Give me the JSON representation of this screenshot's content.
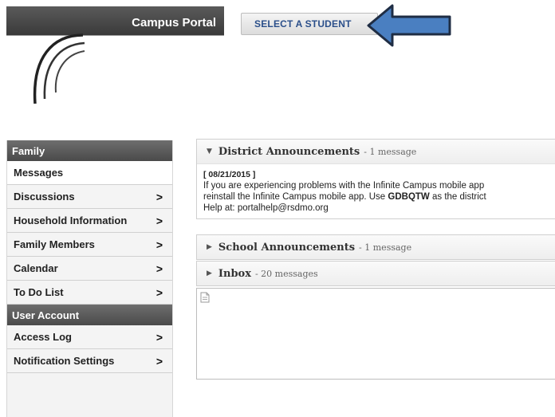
{
  "header": {
    "app_title": "Campus Portal",
    "select_student_label": "SELECT A STUDENT"
  },
  "sidebar": {
    "family_header": "Family",
    "family_items": [
      {
        "label": "Messages",
        "has_chevron": false,
        "active": true
      },
      {
        "label": "Discussions",
        "has_chevron": true
      },
      {
        "label": "Household Information",
        "has_chevron": true
      },
      {
        "label": "Family Members",
        "has_chevron": true
      },
      {
        "label": "Calendar",
        "has_chevron": true
      },
      {
        "label": "To Do List",
        "has_chevron": true
      }
    ],
    "account_header": "User Account",
    "account_items": [
      {
        "label": "Access Log",
        "has_chevron": true
      },
      {
        "label": "Notification Settings",
        "has_chevron": true
      }
    ],
    "chevron": ">"
  },
  "district": {
    "title": "District Announcements",
    "count": "- 1 message",
    "date": "[ 08/21/2015 ]",
    "line1": "If you are experiencing problems with the Infinite Campus mobile app",
    "line2_before": "reinstall the Infinite Campus mobile app.  Use ",
    "line2_code": "GDBQTW",
    "line2_after": " as the district",
    "line3": "Help at:  portalhelp@rsdmo.org"
  },
  "school": {
    "title": "School Announcements",
    "count": "- 1 message"
  },
  "inbox": {
    "title": "Inbox",
    "count": "- 20 messages"
  },
  "colors": {
    "arrow": "#4a7fc1",
    "sidebar_header": "#555555",
    "tab_text": "#2b4f8a"
  },
  "icons": {
    "expanded": "triangle-down-icon",
    "collapsed": "triangle-right-icon",
    "document": "document-icon"
  }
}
